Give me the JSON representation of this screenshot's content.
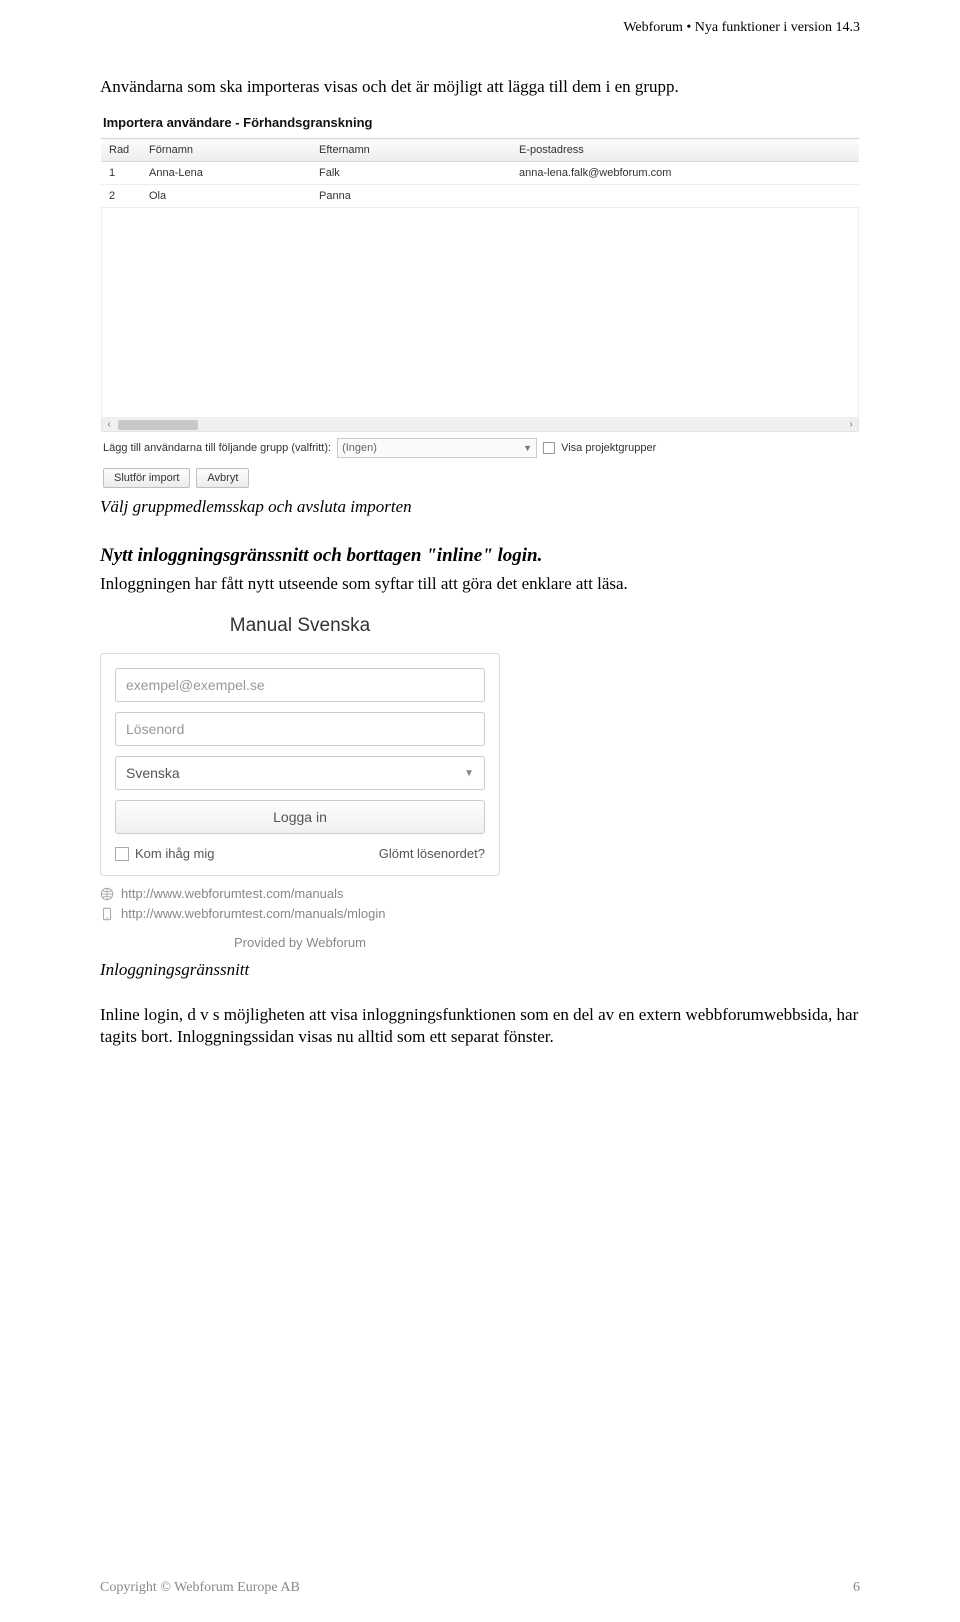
{
  "header": {
    "text": "Webforum • Nya funktioner i version 14.3"
  },
  "intro": "Användarna som ska importeras visas och det är möjligt att lägga till dem i en grupp.",
  "shot1": {
    "title": "Importera användare - Förhandsgranskning",
    "cols": {
      "rad": "Rad",
      "fornamn": "Förnamn",
      "efternamn": "Efternamn",
      "epost": "E-postadress"
    },
    "rows": [
      {
        "rad": "1",
        "fornamn": "Anna-Lena",
        "efternamn": "Falk",
        "epost": "anna-lena.falk@webforum.com"
      },
      {
        "rad": "2",
        "fornamn": "Ola",
        "efternamn": "Panna",
        "epost": ""
      }
    ],
    "scroll": {
      "left": "‹",
      "right": "›"
    },
    "bottom_label": "Lägg till användarna till följande grupp (valfritt):",
    "combo_value": "(Ingen)",
    "checkbox_label": "Visa projektgrupper",
    "btn_finish": "Slutför import",
    "btn_cancel": "Avbryt"
  },
  "caption1": "Välj gruppmedlemsskap och avsluta importen",
  "section_head": "Nytt inloggningsgränssnitt och borttagen \"inline\" login.",
  "para2": "Inloggningen har fått nytt utseende som syftar till att göra det enklare att läsa.",
  "shot2": {
    "title": "Manual Svenska",
    "email_placeholder": "exempel@exempel.se",
    "password_placeholder": "Lösenord",
    "language": "Svenska",
    "login_btn": "Logga in",
    "remember": "Kom ihåg mig",
    "forgot": "Glömt lösenordet?",
    "link1": "http://www.webforumtest.com/manuals",
    "link2": "http://www.webforumtest.com/manuals/mlogin",
    "provided": "Provided by Webforum"
  },
  "caption2": "Inloggningsgränssnitt",
  "para3": "Inline login, d v s möjligheten att visa inloggningsfunktionen som en del av en extern webbforumwebbsida, har tagits bort. Inloggningssidan visas nu alltid som ett separat fönster.",
  "footer": {
    "copyright": "Copyright © Webforum Europe AB",
    "page": "6"
  }
}
